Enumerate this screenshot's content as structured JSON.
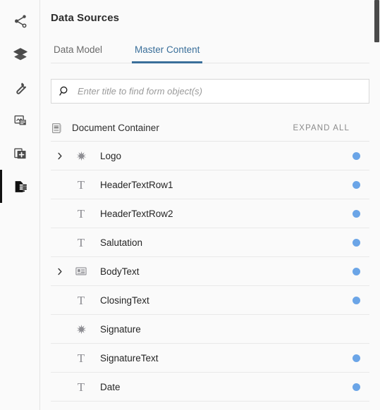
{
  "rail": {
    "items": [
      {
        "name": "share-icon",
        "label": "Share",
        "selected": false
      },
      {
        "name": "layers-icon",
        "label": "Layers",
        "selected": false
      },
      {
        "name": "wrench-icon",
        "label": "Tools",
        "selected": false
      },
      {
        "name": "fragment-icon",
        "label": "Document Fragments",
        "selected": false
      },
      {
        "name": "add-page-icon",
        "label": "Add Page",
        "selected": false
      },
      {
        "name": "data-sources-icon",
        "label": "Data Sources",
        "selected": true
      }
    ]
  },
  "panel": {
    "title": "Data Sources",
    "tabs": [
      {
        "label": "Data Model",
        "active": false
      },
      {
        "label": "Master Content",
        "active": true
      }
    ]
  },
  "search": {
    "placeholder": "Enter title to find form object(s)",
    "value": "",
    "icon": "search-icon"
  },
  "container": {
    "icon": "document-container-icon",
    "label": "Document Container",
    "expand_all_label": "EXPAND ALL"
  },
  "colors": {
    "accent_blue": "#3a6f9a",
    "dot_blue": "#6ba5e7",
    "text_primary": "#252525",
    "text_muted": "#8a8a8a",
    "divider": "#e9e9e9",
    "background": "#fafafa"
  },
  "tree": {
    "rows": [
      {
        "label": "Logo",
        "icon": "asterisk-icon",
        "expandable": true,
        "dot": true
      },
      {
        "label": "HeaderTextRow1",
        "icon": "text-icon",
        "expandable": false,
        "dot": true
      },
      {
        "label": "HeaderTextRow2",
        "icon": "text-icon",
        "expandable": false,
        "dot": true
      },
      {
        "label": "Salutation",
        "icon": "text-icon",
        "expandable": false,
        "dot": true
      },
      {
        "label": "BodyText",
        "icon": "rich-text-icon",
        "expandable": true,
        "dot": true
      },
      {
        "label": "ClosingText",
        "icon": "text-icon",
        "expandable": false,
        "dot": true
      },
      {
        "label": "Signature",
        "icon": "asterisk-icon",
        "expandable": false,
        "dot": false
      },
      {
        "label": "SignatureText",
        "icon": "text-icon",
        "expandable": false,
        "dot": true
      },
      {
        "label": "Date",
        "icon": "text-icon",
        "expandable": false,
        "dot": true
      }
    ]
  },
  "scrollbar": {
    "thumb_top": 0,
    "thumb_height": 60
  }
}
